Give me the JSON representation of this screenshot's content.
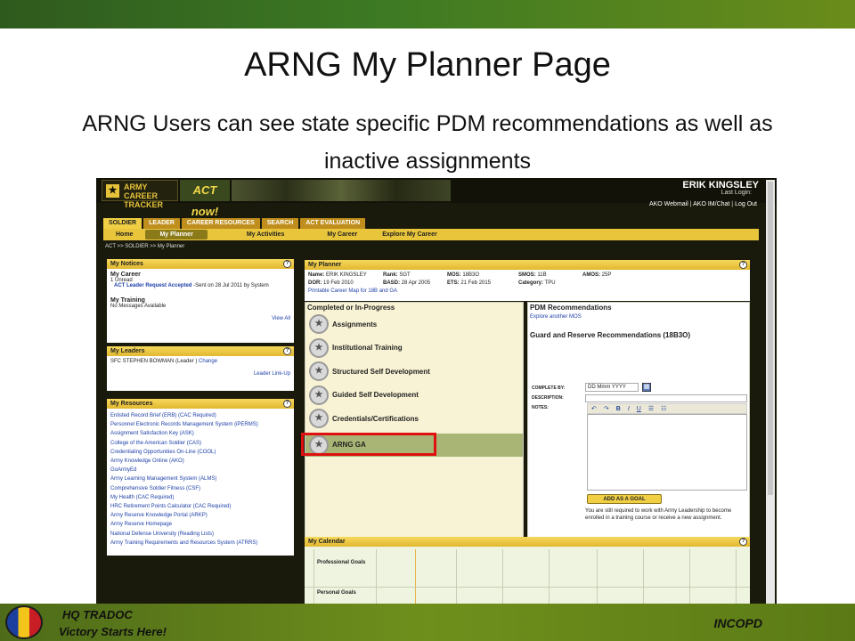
{
  "slide": {
    "title": "ARNG My Planner Page",
    "subtitle": "ARNG Users can see state specific PDM recommendations as well as inactive assignments",
    "footer_left_1": "HQ TRADOC",
    "footer_left_2": "Victory Starts Here!",
    "footer_right": "INCOPD"
  },
  "app": {
    "logo_line1": "ARMY",
    "logo_line2": "CAREER TRACKER",
    "actnow": "ACT now!",
    "user_name": "ERIK KINGSLEY",
    "last_login": "Last Login:",
    "links": [
      "AKO Webmail",
      "AKO IM/Chat",
      "Log Out"
    ],
    "tabs": [
      "SOLDIER",
      "LEADER",
      "CAREER RESOURCES",
      "SEARCH",
      "ACT EVALUATION"
    ],
    "subnav": [
      "Home",
      "My Planner",
      "My Activities",
      "My Career",
      "Explore My Career"
    ],
    "breadcrumb": "ACT >> SOLDIER >> My Planner"
  },
  "notices": {
    "title": "My Notices",
    "career_title": "My Career",
    "unread": "1 Unread",
    "request_link": "ACT Leader Request Accepted",
    "request_info": " -Sent on 28 Jul 2011 by System",
    "training_title": "My Training",
    "no_messages": "No Messages Available",
    "view_all": "View All"
  },
  "leaders": {
    "title": "My Leaders",
    "leader": "SFC STEPHEN BOWMAN (Leader )",
    "change": "Change",
    "link_up": "Leader Link-Up"
  },
  "resources": {
    "title": "My Resources",
    "items": [
      "Enlisted Record Brief (ERB) (CAC Required)",
      "Personnel Electronic Records Management System (iPERMS)",
      "Assignment Satisfaction Key (ASK)",
      "College of the American Soldier (CAS)",
      "Credentialing Opportunities On-Line (COOL)",
      "Army Knowledge Online (AKO)",
      "GoArmyEd",
      "Army Learning Management System (ALMS)",
      "Comprehensive Soldier Fitness (CSF)",
      "My Health (CAC Required)",
      "HRC Retirement Points Calculator (CAC Required)",
      "Army Reserve Knowledge Portal (ARKP)",
      "Army Reserve Homepage",
      "National Defense University (Reading Lists)",
      "Army Training Requirements and Resources System (ATRRS)"
    ]
  },
  "planner": {
    "title": "My Planner",
    "name_label": "Name:",
    "name": "ERIK KINGSLEY",
    "rank_label": "Rank:",
    "rank": "SGT",
    "mos_label": "MOS:",
    "mos": "18B3O",
    "smos_label": "SMOS:",
    "smos": "11B",
    "amos_label": "AMOS:",
    "amos": "25P",
    "dor_label": "DOR:",
    "dor": "19 Feb 2010",
    "basd_label": "BASD:",
    "basd": "28 Apr 2005",
    "ets_label": "ETS:",
    "ets": "21 Feb 2015",
    "category_label": "Category:",
    "category": "TPU",
    "career_map": "Printable Career Map for 18B and GA",
    "completed_title": "Completed or In-Progress",
    "items": [
      "Assignments",
      "Institutional Training",
      "Structured Self Development",
      "Guided Self Development",
      "Credentials/Certifications",
      "ARNG GA"
    ]
  },
  "pdm": {
    "title": "PDM Recommendations",
    "explore": "Explore another MOS",
    "guard_title": "Guard and Reserve Recommendations (18B3O)",
    "complete_by_label": "Complete by:",
    "date_placeholder": "DD Mmm YYYY",
    "description_label": "Description:",
    "notes_label": "Notes:",
    "add_goal": "ADD AS A GOAL",
    "note": "You are still required to work with Army Leadership to become enrolled in a training course or receive a new assignment."
  },
  "calendar": {
    "title": "My Calendar",
    "row1": "Professional Goals",
    "row2": "Personal Goals"
  },
  "colors": {
    "accent_gold": "#e9c53b",
    "highlight_red": "#e01010",
    "selected_item": "#a8b575"
  }
}
